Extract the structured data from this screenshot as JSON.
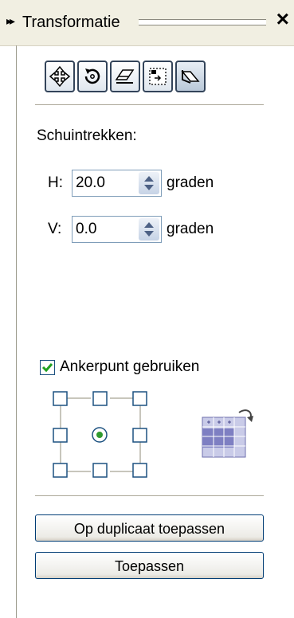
{
  "docker": {
    "title": "Transformatie",
    "collapse_icon": "double-chevron-right",
    "close_icon": "close-x"
  },
  "tabs": [
    {
      "name": "position",
      "icon": "move-arrows-icon"
    },
    {
      "name": "rotate",
      "icon": "rotate-icon"
    },
    {
      "name": "scale-mirror",
      "icon": "scale-mirror-icon"
    },
    {
      "name": "size",
      "icon": "size-icon"
    },
    {
      "name": "skew",
      "icon": "skew-icon",
      "active": true
    }
  ],
  "skew": {
    "section_label": "Schuintrekken:",
    "h": {
      "label": "H:",
      "value": "20.0",
      "unit": "graden"
    },
    "v": {
      "label": "V:",
      "value": "0.0",
      "unit": "graden"
    }
  },
  "anchor": {
    "checkbox_label": "Ankerpunt gebruiken",
    "checked": true,
    "selected_point": "center"
  },
  "buttons": {
    "apply_duplicate": "Op duplicaat toepassen",
    "apply": "Toepassen"
  },
  "colors": {
    "titlebar": "#f1efe2",
    "button_border": "#003c74",
    "check_green": "#21a121",
    "radio_green": "#2f9a2f"
  }
}
